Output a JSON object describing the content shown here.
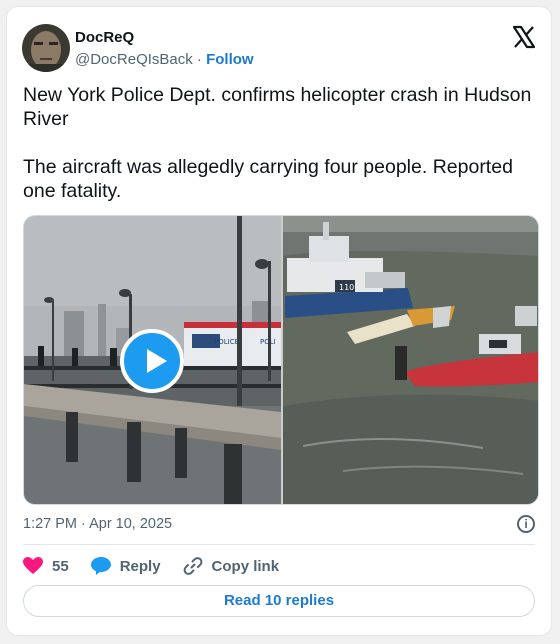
{
  "author": {
    "name": "DocReQ",
    "handle": "@DocReQIsBack",
    "separator": " · ",
    "follow_label": "Follow"
  },
  "post": {
    "text": "New York Police Dept. confirms helicopter crash in Hudson River\n\nThe aircraft was allegedly carrying four people. Reported one fatality.",
    "timestamp": "1:27 PM · Apr 10, 2025",
    "info_glyph": "i"
  },
  "media": {
    "left_sign_1": "POLICE",
    "left_sign_2": "POLI",
    "boat_number": "110"
  },
  "actions": {
    "like_count": "55",
    "reply_label": "Reply",
    "copy_label": "Copy link",
    "read_replies_label": "Read 10 replies"
  },
  "colors": {
    "like": "#f91880",
    "reply": "#1d9bf0",
    "link": "#1d7ad1"
  },
  "icons": [
    "x-logo-icon",
    "play-icon",
    "info-icon",
    "heart-icon",
    "reply-bubble-icon",
    "link-icon"
  ]
}
